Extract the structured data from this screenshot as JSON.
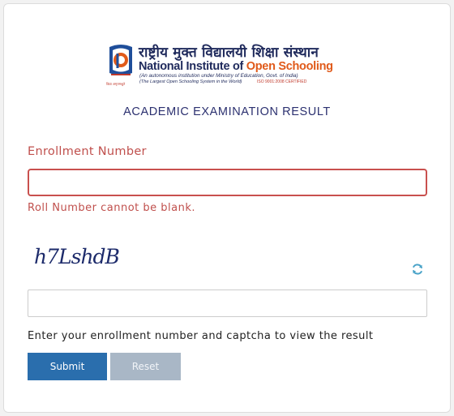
{
  "header": {
    "hindi_name": "राष्ट्रीय मुक्त विद्यालयी शिक्षा संस्थान",
    "name_part1": "National Institute of ",
    "name_part2": "Open Schooling",
    "subtitle": "(An autonomous institution under Ministry of Education, Govt. of India)",
    "tagline": "(The Largest Open Schooling System in the World)",
    "iso": "ISO 9001:2008 CERTIFIED",
    "emblem_caption": "विद्या अमृतमश्नुते",
    "page_title": "ACADEMIC EXAMINATION RESULT"
  },
  "form": {
    "enrollment_label": "Enrollment Number",
    "enrollment_value": "",
    "enrollment_error": "Roll Number cannot be blank.",
    "captcha_text": "h7LshdB",
    "captcha_value": "",
    "refresh_icon": "refresh-icon",
    "hint": "Enter your enrollment number and captcha to view the result",
    "submit_label": "Submit",
    "reset_label": "Reset"
  },
  "colors": {
    "navy": "#2c3170",
    "error": "#c0504d",
    "submit": "#2a6ead",
    "reset": "#a9b7c6",
    "brand_orange": "#e05a1a"
  }
}
